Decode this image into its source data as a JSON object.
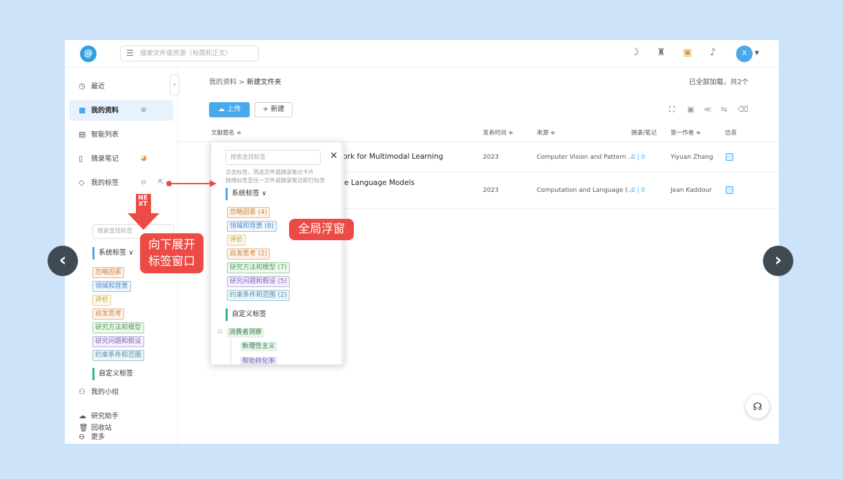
{
  "topbar": {
    "search_placeholder": "搜索文件或资源（标题和正文）",
    "avatar_initial": "X"
  },
  "sidebar": {
    "items": [
      {
        "label": "最近",
        "icon": "clock-icon"
      },
      {
        "label": "我的资料",
        "icon": "book-icon"
      },
      {
        "label": "智能列表",
        "icon": "list-icon"
      },
      {
        "label": "摘录笔记",
        "icon": "notebook-icon"
      },
      {
        "label": "我的标签",
        "icon": "tag-icon"
      },
      {
        "label": "我的小组",
        "icon": "group-icon"
      },
      {
        "label": "研究助手",
        "icon": "assistant-icon"
      },
      {
        "label": "更多",
        "icon": "more-icon"
      },
      {
        "label": "回收站",
        "icon": "trash-icon"
      }
    ],
    "tag_search_placeholder": "搜索查找标签",
    "system_tags_label": "系统标签",
    "custom_tags_label": "自定义标签",
    "system_tags": [
      "忽略因素",
      "领域和背景",
      "评价",
      "启发思考",
      "研究方法和模型",
      "研究问题和假设",
      "约束条件和范围"
    ]
  },
  "main": {
    "breadcrumb_root": "我的资料",
    "breadcrumb_sep": ">",
    "breadcrumb_current": "新建文件夹",
    "loaded_status": "已全部加载，共2个",
    "upload_label": "上传",
    "new_label": "+ 新建",
    "columns": [
      "文献题名 ≑",
      "发表时间 ≑",
      "来源 ≑",
      "摘录/笔记",
      "第一作者 ≑",
      "信息"
    ],
    "rows": [
      {
        "title": "vork for Multimodal Learning",
        "year": "2023",
        "source": "Computer Vision and Pattern ...",
        "notes": "0 | 0",
        "author": "Yiyuan Zhang"
      },
      {
        "title": "e Language Models",
        "year": "2023",
        "source": "Computation and Language (...",
        "notes": "0 | 0",
        "author": "Jean Kaddour"
      }
    ]
  },
  "popup": {
    "search_placeholder": "搜索查找标签",
    "hint_1": "点击标签，筛选文件或摘录笔记卡片",
    "hint_2": "拖拽标签至任一文件或摘录笔记即打标签",
    "system_tags_label": "系统标签 ∨",
    "system_tags": [
      "忽略因素 (4)",
      "领域和背景 (8)",
      "评价",
      "启发思考 (2)",
      "研究方法和模型 (7)",
      "研究问题和假设 (5)",
      "约束条件和范围 (2)"
    ],
    "custom_tags_label": "自定义标签",
    "custom_group": "消费者洞察",
    "custom_child_1": "新理性主义",
    "custom_child_2": "帮助转化率"
  },
  "annotations": {
    "expand_line_1": "向下展开",
    "expand_line_2": "标签窗口",
    "next_label": "NEXT",
    "global_float": "全局浮窗"
  },
  "colors": {
    "accent": "#4aa8ec",
    "annotation": "#ec4b45",
    "background": "#cde3fa"
  }
}
